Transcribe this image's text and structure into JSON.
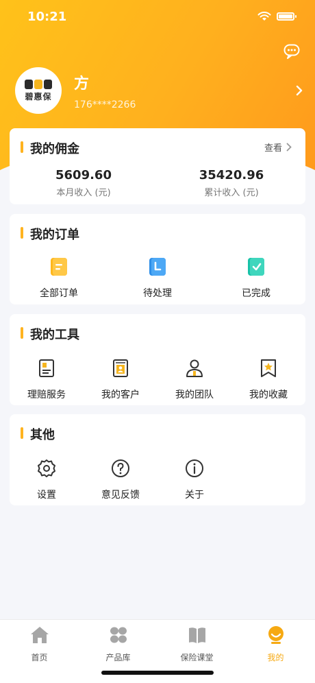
{
  "status_bar": {
    "time": "10:21"
  },
  "profile": {
    "name": "方",
    "phone": "176****2266",
    "logo_text": "碧惠保"
  },
  "commission": {
    "title": "我的佣金",
    "view_label": "查看",
    "monthly_value": "5609.60",
    "monthly_label": "本月收入 (元)",
    "total_value": "35420.96",
    "total_label": "累计收入 (元)"
  },
  "orders": {
    "title": "我的订单",
    "items": [
      {
        "label": "全部订单",
        "icon": "all-orders-icon"
      },
      {
        "label": "待处理",
        "icon": "pending-icon"
      },
      {
        "label": "已完成",
        "icon": "completed-icon"
      }
    ]
  },
  "tools": {
    "title": "我的工具",
    "items": [
      {
        "label": "理赔服务",
        "icon": "claim-service-icon"
      },
      {
        "label": "我的客户",
        "icon": "customers-icon"
      },
      {
        "label": "我的团队",
        "icon": "team-icon"
      },
      {
        "label": "我的收藏",
        "icon": "favorites-icon"
      }
    ]
  },
  "others": {
    "title": "其他",
    "items": [
      {
        "label": "设置",
        "icon": "gear-icon"
      },
      {
        "label": "意见反馈",
        "icon": "question-icon"
      },
      {
        "label": "关于",
        "icon": "info-icon"
      }
    ]
  },
  "bottom_nav": {
    "items": [
      {
        "label": "首页",
        "icon": "home-icon"
      },
      {
        "label": "产品库",
        "icon": "grid-icon"
      },
      {
        "label": "保险课堂",
        "icon": "book-icon"
      },
      {
        "label": "我的",
        "icon": "profile-icon",
        "active": true
      }
    ]
  },
  "colors": {
    "accent": "#ffb31f",
    "active_nav": "#f6a912",
    "background": "#f5f6fa"
  }
}
